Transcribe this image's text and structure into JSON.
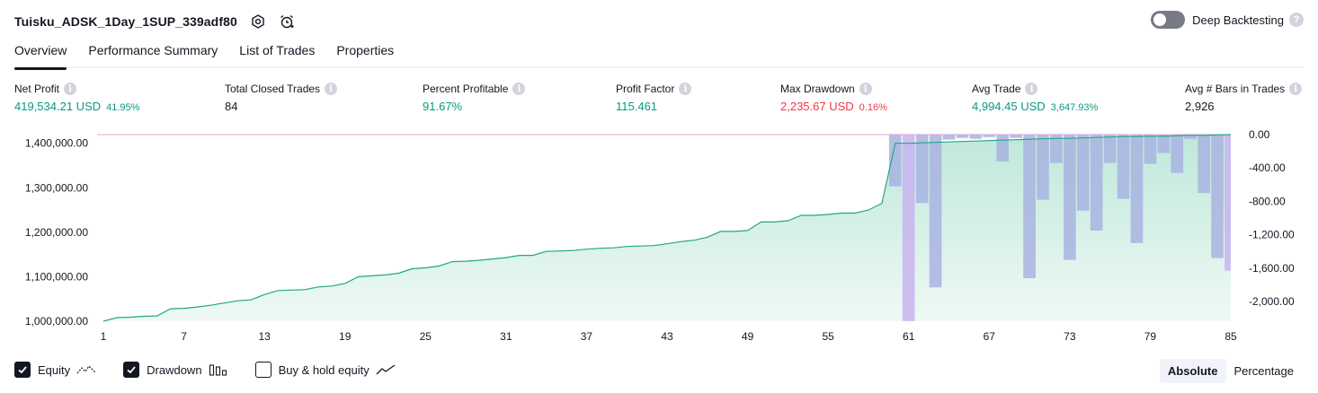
{
  "header": {
    "title": "Tuisku_ADSK_1Day_1SUP_339adf80",
    "deep_backtesting_label": "Deep Backtesting",
    "deep_backtesting_enabled": false
  },
  "tabs": [
    {
      "label": "Overview",
      "active": true
    },
    {
      "label": "Performance Summary",
      "active": false
    },
    {
      "label": "List of Trades",
      "active": false
    },
    {
      "label": "Properties",
      "active": false
    }
  ],
  "metrics": {
    "net_profit": {
      "label": "Net Profit",
      "value": "419,534.21 USD",
      "pct": "41.95%"
    },
    "total_closed_trades": {
      "label": "Total Closed Trades",
      "value": "84"
    },
    "percent_profitable": {
      "label": "Percent Profitable",
      "value": "91.67%"
    },
    "profit_factor": {
      "label": "Profit Factor",
      "value": "115.461"
    },
    "max_drawdown": {
      "label": "Max Drawdown",
      "value": "2,235.67 USD",
      "pct": "0.16%"
    },
    "avg_trade": {
      "label": "Avg Trade",
      "value": "4,994.45 USD",
      "pct": "3,647.93%"
    },
    "avg_bars": {
      "label": "Avg # Bars in Trades",
      "value": "2,926"
    }
  },
  "legend": {
    "equity": {
      "label": "Equity",
      "checked": true
    },
    "drawdown": {
      "label": "Drawdown",
      "checked": true
    },
    "buy_hold": {
      "label": "Buy & hold equity",
      "checked": false
    }
  },
  "view_toggle": {
    "absolute": "Absolute",
    "percentage": "Percentage",
    "selected": "Absolute"
  },
  "colors": {
    "equity_line": "#22a68a",
    "equity_fill_top": "#bfe8da",
    "equity_fill_bottom": "#eef9f5",
    "drawdown_bar": "#a9b3e0",
    "drawdown_bar_alt": "#c9b3f0",
    "zero_line": "#e7a3d3"
  },
  "chart_data": {
    "type": "area",
    "x_ticks": [
      "1",
      "7",
      "13",
      "19",
      "25",
      "31",
      "37",
      "43",
      "49",
      "55",
      "61",
      "67",
      "73",
      "79",
      "85"
    ],
    "left_axis": {
      "label": "",
      "ticks": [
        "1,000,000.00",
        "1,100,000.00",
        "1,200,000.00",
        "1,300,000.00",
        "1,400,000.00"
      ],
      "ylim": [
        1000000,
        1419534
      ]
    },
    "right_axis": {
      "label": "",
      "ticks": [
        "0.00",
        "-400.00",
        "-800.00",
        "-1,200.00",
        "-1,600.00",
        "-2,000.00"
      ],
      "ylim": [
        -2235.67,
        0
      ]
    },
    "series": [
      {
        "type": "area",
        "axis": "left",
        "x": [
          1,
          2,
          3,
          4,
          5,
          6,
          7,
          8,
          9,
          10,
          11,
          12,
          13,
          14,
          15,
          16,
          17,
          18,
          19,
          20,
          21,
          22,
          23,
          24,
          25,
          26,
          27,
          28,
          29,
          30,
          31,
          32,
          33,
          34,
          35,
          36,
          37,
          38,
          39,
          40,
          41,
          42,
          43,
          44,
          45,
          46,
          47,
          48,
          49,
          50,
          51,
          52,
          53,
          54,
          55,
          56,
          57,
          58,
          59,
          60,
          61,
          62,
          63,
          64,
          65,
          66,
          67,
          68,
          69,
          70,
          71,
          72,
          73,
          74,
          75,
          76,
          77,
          78,
          79,
          80,
          81,
          82,
          83,
          84,
          85
        ],
        "values": [
          1000000,
          1008000,
          1009000,
          1011000,
          1012000,
          1028000,
          1029000,
          1032000,
          1036000,
          1041000,
          1046000,
          1048000,
          1060000,
          1069000,
          1070000,
          1071000,
          1077000,
          1079000,
          1085000,
          1100000,
          1102000,
          1104000,
          1108000,
          1118000,
          1120000,
          1124000,
          1134000,
          1135000,
          1137000,
          1140000,
          1143000,
          1148000,
          1148000,
          1157000,
          1158000,
          1159000,
          1162000,
          1164000,
          1165000,
          1168000,
          1169000,
          1170000,
          1174000,
          1179000,
          1182000,
          1189000,
          1202000,
          1202000,
          1204000,
          1223000,
          1223000,
          1226000,
          1238000,
          1238000,
          1240000,
          1243000,
          1243000,
          1250000,
          1265000,
          1400000,
          1400000,
          1401000,
          1402000,
          1403000,
          1404000,
          1405000,
          1406000,
          1407000,
          1408000,
          1409000,
          1410000,
          1411000,
          1411000,
          1412000,
          1413000,
          1414000,
          1415000,
          1415000,
          1416000,
          1416000,
          1417000,
          1418000,
          1418000,
          1419000,
          1419534
        ]
      },
      {
        "type": "bar",
        "axis": "right",
        "x": [
          60,
          61,
          62,
          63,
          64,
          65,
          66,
          67,
          68,
          69,
          70,
          71,
          72,
          73,
          74,
          75,
          76,
          77,
          78,
          79,
          80,
          81,
          82,
          83,
          84,
          85
        ],
        "values": [
          -620,
          -2235,
          -820,
          -1830,
          -60,
          -40,
          -50,
          -30,
          -320,
          -40,
          -1720,
          -780,
          -340,
          -1500,
          -910,
          -1150,
          -340,
          -770,
          -1300,
          -350,
          -220,
          -460,
          -50,
          -700,
          -1480,
          -1630
        ]
      }
    ]
  }
}
